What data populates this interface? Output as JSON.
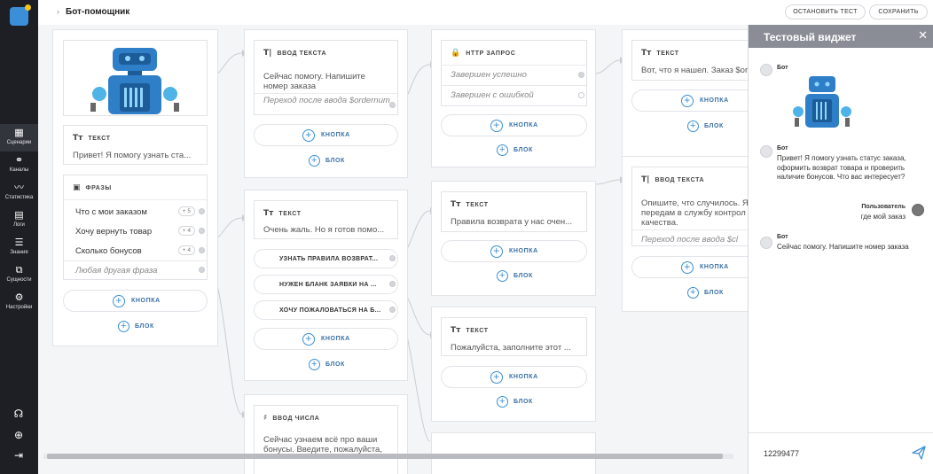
{
  "sidebar": {
    "items": [
      {
        "label": "Сценарии",
        "icon": "grid-icon",
        "glyph": "▦"
      },
      {
        "label": "Каналы",
        "icon": "channels-icon",
        "glyph": "⚭"
      },
      {
        "label": "Статистика",
        "icon": "chart-icon",
        "glyph": "〰"
      },
      {
        "label": "Логи",
        "icon": "book-icon",
        "glyph": "▤"
      },
      {
        "label": "Знания",
        "icon": "database-icon",
        "glyph": "☰"
      },
      {
        "label": "Сущности",
        "icon": "entities-icon",
        "glyph": "⧉"
      },
      {
        "label": "Настройки",
        "icon": "gear-icon",
        "glyph": "⚙"
      }
    ],
    "bottom": [
      {
        "icon": "headset-icon",
        "glyph": "☊"
      },
      {
        "icon": "globe-icon",
        "glyph": "⊕"
      },
      {
        "icon": "logout-icon",
        "glyph": "⇥"
      }
    ]
  },
  "topbar": {
    "breadcrumb": "Бот-помощник",
    "stop_test": "ОСТАНОВИТЬ ТЕСТ",
    "save": "СОХРАНИТЬ"
  },
  "colors": {
    "sidebar": "#1e1f24",
    "accent": "#3a8fd6",
    "widget_header": "#8a8d95",
    "robot_blue": "#2f7fc8"
  },
  "canvas": {
    "b1": {
      "text_head": "ТЕКСТ",
      "text_body": "Привет! Я помогу узнать ста...",
      "phrases_head": "ФРАЗЫ",
      "phrases": [
        {
          "text": "Что с мои заказом",
          "count": "+ 5"
        },
        {
          "text": "Хочу вернуть товар",
          "count": "+ 4"
        },
        {
          "text": "Сколько бонусов",
          "count": "+ 4"
        }
      ],
      "phrase_other": "Любая другая фраза",
      "button": "КНОПКА",
      "block": "БЛОК"
    },
    "b2": {
      "head": "ВВОД ТЕКСТА",
      "body": "Сейчас помогу. Напишите номер заказа",
      "after": "Переход после ввода $ordernum",
      "button": "КНОПКА",
      "block": "БЛОК"
    },
    "b3": {
      "head": "ТЕКСТ",
      "body": "Очень жаль. Но я готов помо...",
      "buttons": [
        "УЗНАТЬ ПРАВИЛА ВОЗВРАТ...",
        "НУЖЕН БЛАНК ЗАЯВКИ НА ...",
        "ХОЧУ ПОЖАЛОВАТЬСЯ НА Б..."
      ],
      "button": "КНОПКА",
      "block": "БЛОК"
    },
    "b4": {
      "head": "ВВОД ЧИСЛА",
      "body": "Сейчас узнаем всё про ваши бонусы. Введите, пожалуйста,"
    },
    "b5": {
      "head": "HTTP ЗАПРОС",
      "ok": "Завершен успешно",
      "err": "Завершен с ошибкой",
      "button": "КНОПКА",
      "block": "БЛОК"
    },
    "b6": {
      "head": "ТЕКСТ",
      "body": "Правила возврата у нас очен...",
      "button": "КНОПКА",
      "block": "БЛОК"
    },
    "b7": {
      "head": "ТЕКСТ",
      "body": "Пожалуйста, заполните этот ...",
      "button": "КНОПКА",
      "block": "БЛОК"
    },
    "b8": {
      "head": "ТЕКСТ",
      "body": "Вот, что я нашел. Заказ $or",
      "button": "КНОПКА",
      "block": "БЛОК"
    },
    "b9": {
      "head": "ВВОД ТЕКСТА",
      "body": "Опишите, что случилось. Я передам в службу контрол качества.",
      "after": "Переход после ввода $cl",
      "button": "КНОПКА",
      "block": "БЛОК"
    }
  },
  "widget": {
    "title": "Тестовый виджет",
    "messages": [
      {
        "from": "Бот",
        "text": ""
      },
      {
        "from": "Бот",
        "text": "Привет! Я помогу узнать статус заказа, оформить возврат товара и проверить наличие бонусов. Что вас интересует?"
      },
      {
        "from": "Пользователь",
        "text": "где мой заказ"
      },
      {
        "from": "Бот",
        "text": "Сейчас помогу. Напишите номер заказа"
      }
    ],
    "input_value": "12299477"
  }
}
